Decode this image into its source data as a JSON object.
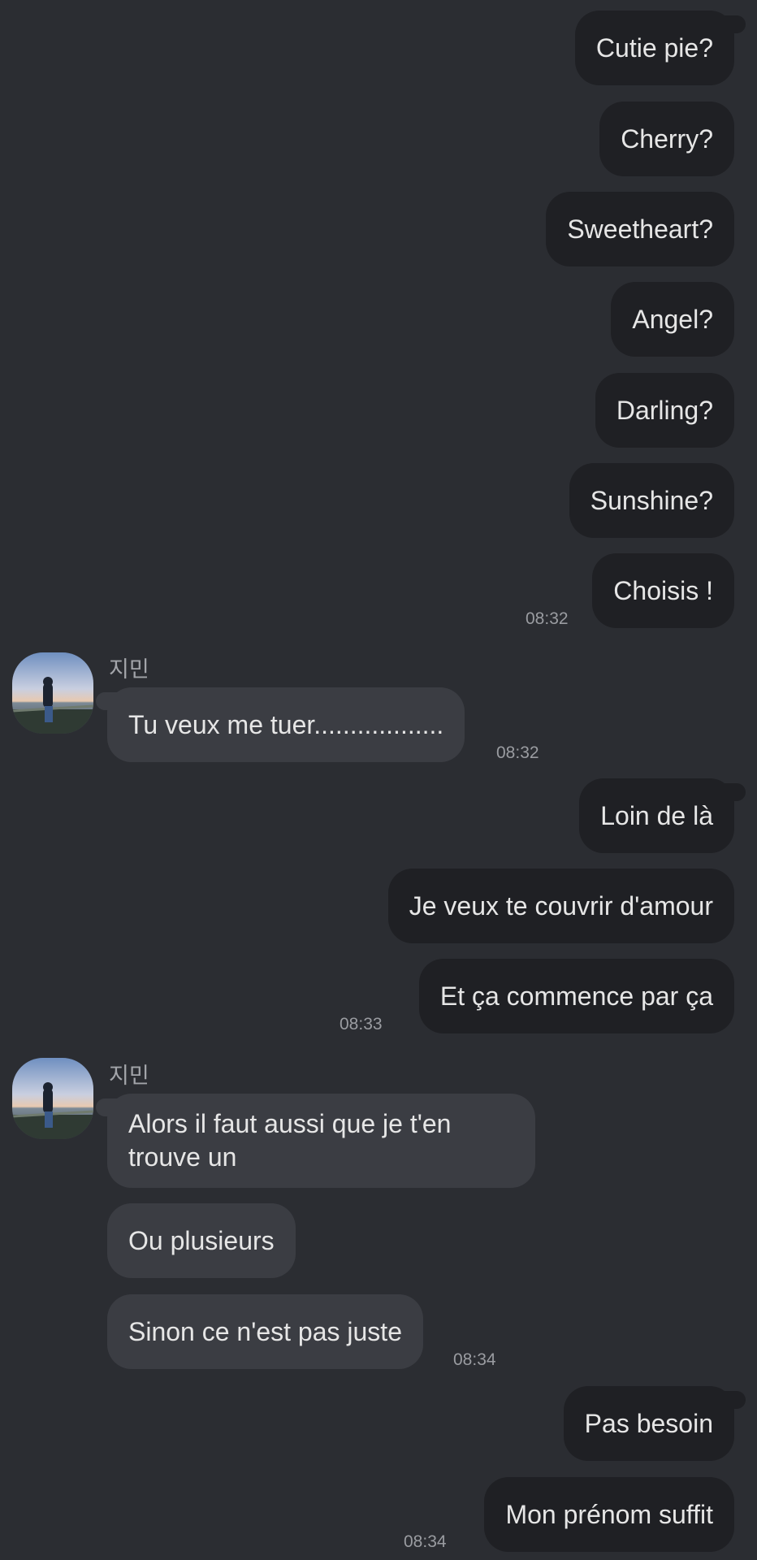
{
  "messages": {
    "m1": "Cutie pie?",
    "m2": "Cherry?",
    "m3": "Sweetheart?",
    "m4": "Angel?",
    "m5": "Darling?",
    "m6": "Sunshine?",
    "m7": "Choisis !",
    "m8": "Tu veux me tuer..................",
    "m9": "Loin de là",
    "m10": "Je veux te couvrir d'amour",
    "m11": "Et ça commence par ça",
    "m12": "Alors il faut aussi que je t'en trouve un",
    "m13": "Ou plusieurs",
    "m14": "Sinon ce n'est pas juste",
    "m15": "Pas besoin",
    "m16": "Mon prénom suffit"
  },
  "times": {
    "t1": "08:32",
    "t2": "08:32",
    "t3": "08:33",
    "t4": "08:34",
    "t5": "08:34"
  },
  "contact": {
    "name": "지민"
  },
  "colors": {
    "background": "#2b2d32",
    "outgoing_bubble": "#1f2024",
    "incoming_bubble": "#3b3d43"
  }
}
